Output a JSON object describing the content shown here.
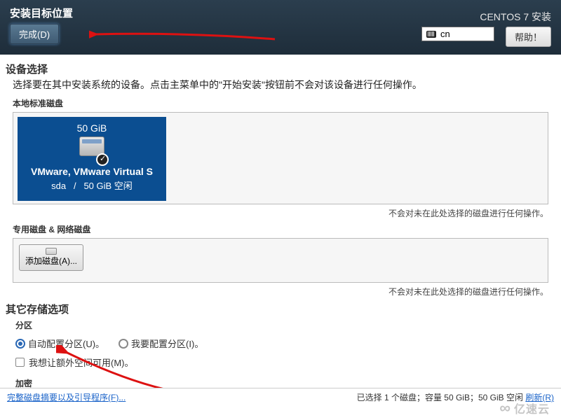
{
  "header": {
    "title": "安装目标位置",
    "done_button": "完成(D)",
    "product": "CENTOS 7 安装",
    "lang": "cn",
    "help": "帮助！"
  },
  "device": {
    "heading": "设备选择",
    "description": "选择要在其中安装系统的设备。点击主菜单中的\"开始安装\"按钮前不会对该设备进行任何操作。",
    "local_label": "本地标准磁盘",
    "disk": {
      "size": "50 GiB",
      "name": "VMware, VMware Virtual S",
      "dev": "sda",
      "sep": "/",
      "free": "50 GiB 空闲"
    },
    "unselected_note": "不会对未在此处选择的磁盘进行任何操作。",
    "special_label": "专用磁盘 & 网络磁盘",
    "add_disk": "添加磁盘(A)..."
  },
  "storage": {
    "heading": "其它存储选项",
    "partition_label": "分区",
    "auto": "自动配置分区(U)。",
    "manual": "我要配置分区(I)。",
    "extra_space": "我想让额外空间可用(M)。",
    "encrypt_label": "加密"
  },
  "bottom": {
    "summary_link": "完整磁盘摘要以及引导程序(F)...",
    "status_prefix": "已选择 1 个磁盘；容量 50 GiB；50 GiB 空闲 ",
    "refresh_link": "刷新(R)"
  },
  "watermark": "亿速云"
}
